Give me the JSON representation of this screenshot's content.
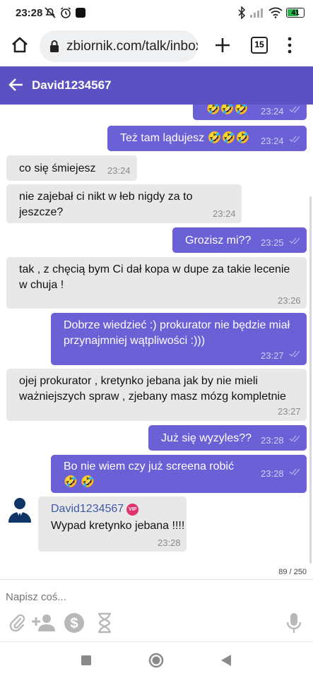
{
  "status_bar": {
    "time": "23:28",
    "battery": "41"
  },
  "browser": {
    "url": "zbiornik.com/talk/inbox",
    "tab_count": "15"
  },
  "chat": {
    "contact_name": "David1234567"
  },
  "messages": [
    {
      "direction": "sent",
      "text": "🤣🤣🤣",
      "time": "23:24"
    },
    {
      "direction": "sent",
      "text": "Też tam lądujesz 🤣🤣🤣",
      "time": "23:24"
    },
    {
      "direction": "received",
      "text": "co się śmiejesz",
      "time": "23:24"
    },
    {
      "direction": "received",
      "text": "nie zajebał ci nikt w łeb nigdy za to jeszcze?",
      "time": "23:24"
    },
    {
      "direction": "sent",
      "text": "Grozisz mi??",
      "time": "23:25"
    },
    {
      "direction": "received",
      "text": "tak , z chęcią bym Ci dał kopa w dupe za takie lecenie w chuja !",
      "time": "23:26"
    },
    {
      "direction": "sent",
      "text": "Dobrze wiedzieć :) prokurator nie będzie miał przynajmniej wątpliwości :)))",
      "time": "23:27"
    },
    {
      "direction": "received",
      "text": "ojej prokurator , kretynko jebana jak by nie mieli ważniejszych spraw , zjebany masz mózg kompletnie",
      "time": "23:27"
    },
    {
      "direction": "sent",
      "text": "Już się wyzyles??",
      "time": "23:28"
    },
    {
      "direction": "sent",
      "text": "Bo nie wiem czy już screena robić 🤣 🤣",
      "time": "23:28"
    },
    {
      "direction": "received",
      "sender": "David1234567",
      "badge": "VIP",
      "text": "Wypad kretynko jebana !!!!",
      "time": "23:28"
    }
  ],
  "char_counter": "89 / 250",
  "composer": {
    "placeholder": "Napisz coś..."
  },
  "colors": {
    "header": "#5b51c2",
    "sent_bubble": "#6b60d6",
    "received_bubble": "#e8e8e8",
    "vip_badge": "#e0336e"
  },
  "icons": [
    "home-icon",
    "lock-icon",
    "plus-icon",
    "tabs-icon",
    "more-vert-icon",
    "back-arrow-icon",
    "read-check-icon",
    "attach-icon",
    "add-person-icon",
    "dollar-icon",
    "hourglass-icon",
    "microphone-icon",
    "recents-icon",
    "home-circle-icon",
    "back-triangle-icon"
  ]
}
